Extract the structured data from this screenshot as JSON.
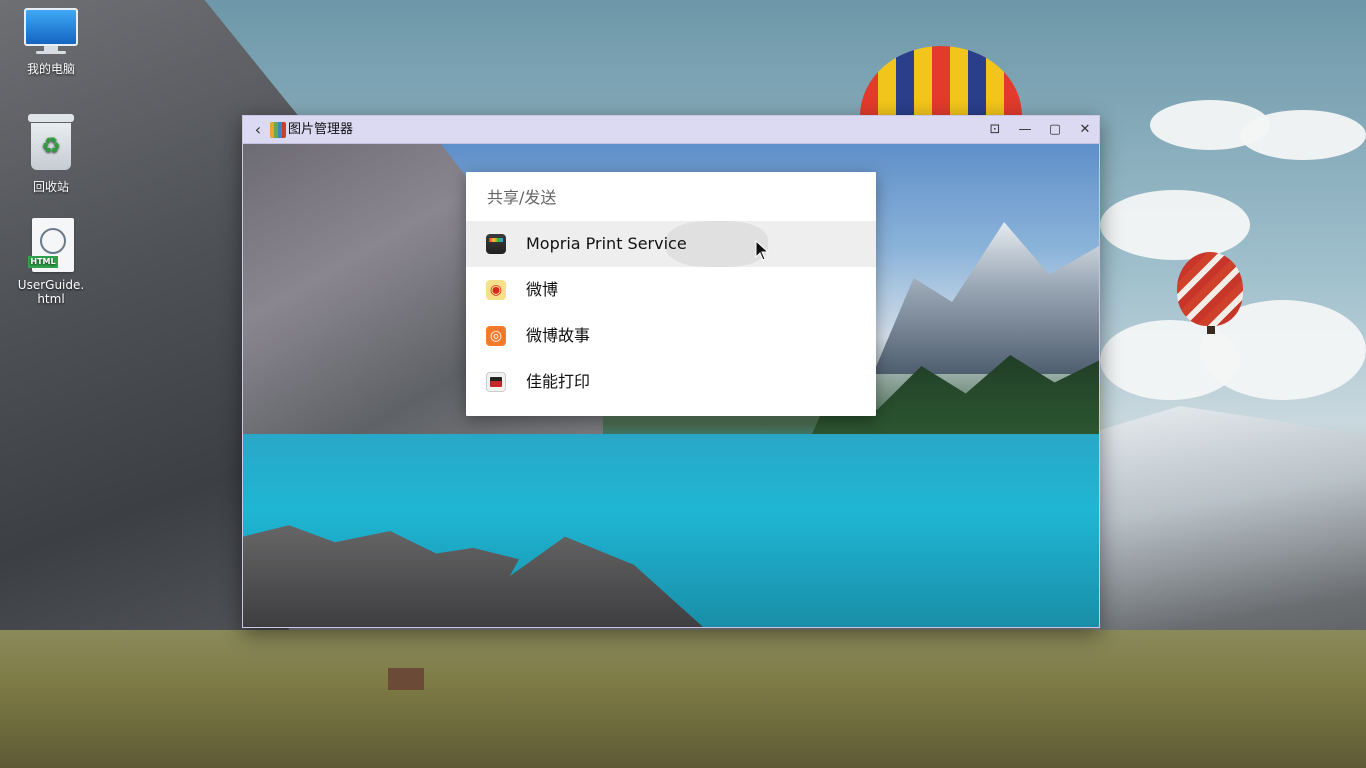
{
  "desktop": {
    "icons": [
      {
        "label": "我的电脑",
        "icon": "computer-icon"
      },
      {
        "label": "回收站",
        "icon": "recycle-bin-icon"
      },
      {
        "label": "UserGuide.html",
        "icon": "html-file-icon",
        "badge": "HTML"
      }
    ]
  },
  "window": {
    "title": "图片管理器",
    "back_glyph": "‹",
    "controls": {
      "lock_glyph": "⊡",
      "minimize_glyph": "—",
      "maximize_glyph": "▢",
      "close_glyph": "✕"
    }
  },
  "share_menu": {
    "title": "共享/发送",
    "items": [
      {
        "label": "Mopria Print Service",
        "icon": "mopria-icon",
        "hovered": true
      },
      {
        "label": "微博",
        "icon": "weibo-icon"
      },
      {
        "label": "微博故事",
        "icon": "weibo-story-icon"
      },
      {
        "label": "佳能打印",
        "icon": "canon-print-icon"
      }
    ]
  },
  "colors": {
    "titlebar": "#dcd9f3",
    "menu_hover": "#eeeeee"
  }
}
